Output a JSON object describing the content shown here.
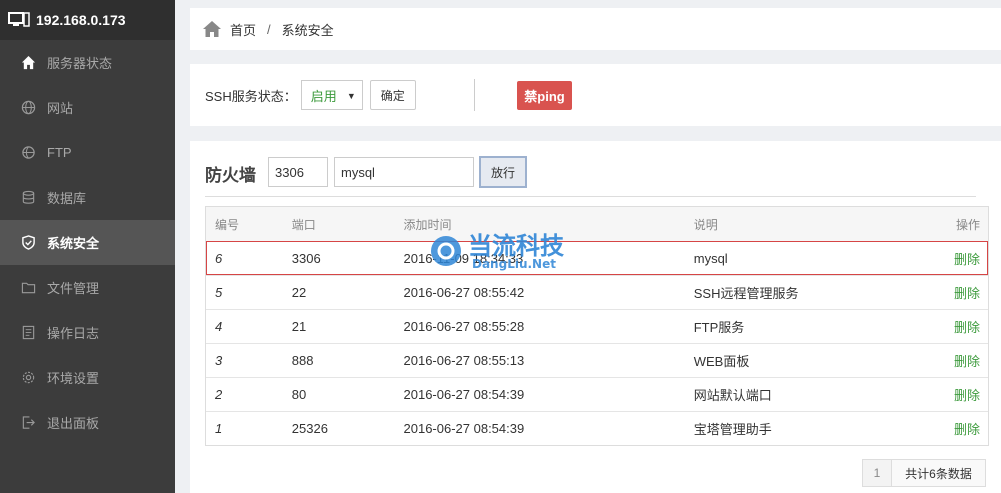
{
  "sidebar": {
    "host": "192.168.0.173",
    "items": [
      {
        "label": "服务器状态",
        "icon": "home-icon"
      },
      {
        "label": "网站",
        "icon": "globe-icon"
      },
      {
        "label": "FTP",
        "icon": "ftp-icon"
      },
      {
        "label": "数据库",
        "icon": "database-icon"
      },
      {
        "label": "系统安全",
        "icon": "shield-icon"
      },
      {
        "label": "文件管理",
        "icon": "folder-icon"
      },
      {
        "label": "操作日志",
        "icon": "log-icon"
      },
      {
        "label": "环境设置",
        "icon": "gear-icon"
      },
      {
        "label": "退出面板",
        "icon": "logout-icon"
      }
    ]
  },
  "breadcrumb": {
    "home": "首页",
    "separator": "/",
    "current": "系统安全"
  },
  "ssh": {
    "label": "SSH服务状态：",
    "status": "启用",
    "confirm": "确定",
    "ping_button": "禁ping"
  },
  "firewall": {
    "title": "防火墙",
    "port_value": "3306",
    "desc_value": "mysql",
    "allow_button": "放行",
    "headers": [
      "编号",
      "端口",
      "添加时间",
      "说明",
      "操作"
    ],
    "rows": [
      {
        "id": "6",
        "port": "3306",
        "time": "2016-11-09 18:34:33",
        "desc": "mysql",
        "action": "删除"
      },
      {
        "id": "5",
        "port": "22",
        "time": "2016-06-27 08:55:42",
        "desc": "SSH远程管理服务",
        "action": "删除"
      },
      {
        "id": "4",
        "port": "21",
        "time": "2016-06-27 08:55:28",
        "desc": "FTP服务",
        "action": "删除"
      },
      {
        "id": "3",
        "port": "888",
        "time": "2016-06-27 08:55:13",
        "desc": "WEB面板",
        "action": "删除"
      },
      {
        "id": "2",
        "port": "80",
        "time": "2016-06-27 08:54:39",
        "desc": "网站默认端口",
        "action": "删除"
      },
      {
        "id": "1",
        "port": "25326",
        "time": "2016-06-27 08:54:39",
        "desc": "宝塔管理助手",
        "action": "删除"
      }
    ]
  },
  "pagination": {
    "page": "1",
    "total": "共计6条数据"
  },
  "watermark": {
    "name": "当流科技",
    "site": "DangLiu.Net"
  },
  "colors": {
    "sidebar_bg": "#3c3c3c",
    "accent_green": "#3c9a3c",
    "danger_red": "#d9534f"
  }
}
